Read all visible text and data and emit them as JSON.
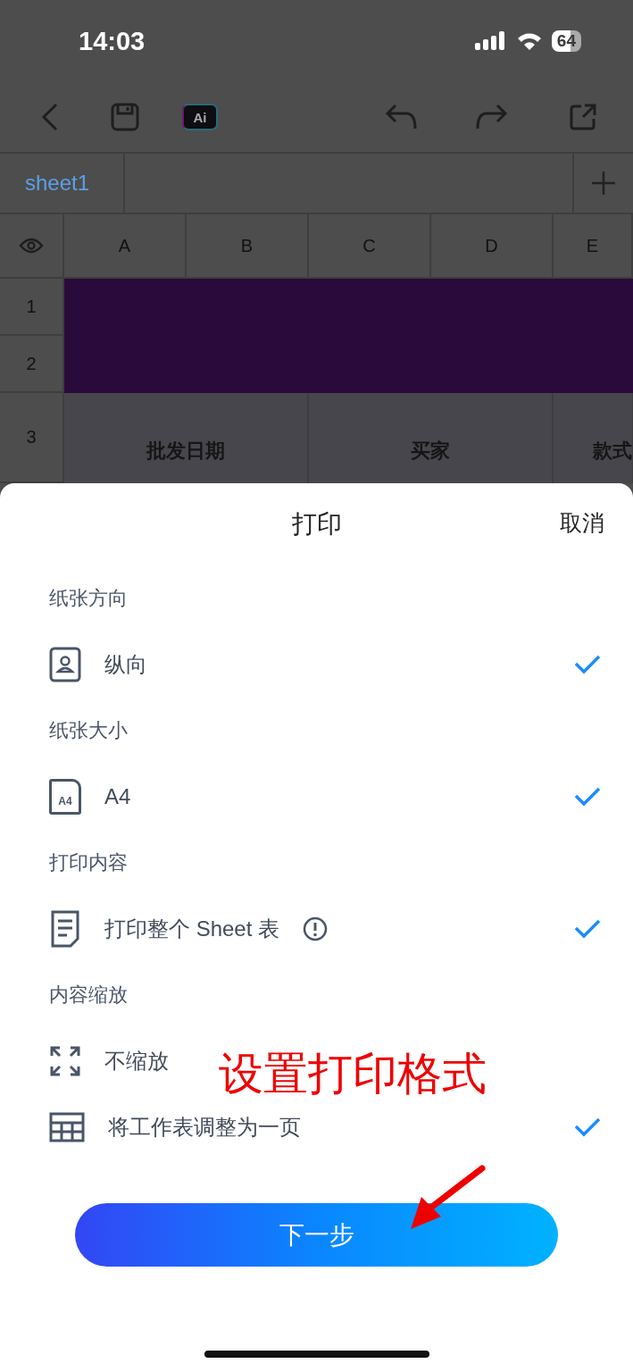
{
  "status_bar": {
    "time": "14:03",
    "battery": "64"
  },
  "toolbar": {
    "ai_button": "Ai"
  },
  "sheet_tabs": [
    {
      "label": "sheet1",
      "selected": true
    }
  ],
  "columns": [
    "A",
    "B",
    "C",
    "D",
    "E"
  ],
  "row_numbers": [
    "1",
    "2",
    "3"
  ],
  "header_cells": [
    "批发日期",
    "买家",
    "款式"
  ],
  "print_dialog": {
    "title": "打印",
    "cancel": "取消",
    "sections": [
      {
        "label": "纸张方向",
        "options": [
          {
            "kind": "portrait",
            "label": "纵向",
            "checked": true
          }
        ]
      },
      {
        "label": "纸张大小",
        "options": [
          {
            "kind": "paper",
            "icon_label": "A4",
            "label": "A4",
            "checked": true
          }
        ]
      },
      {
        "label": "打印内容",
        "options": [
          {
            "kind": "document",
            "label": "打印整个 Sheet 表",
            "info": true,
            "checked": true
          }
        ]
      },
      {
        "label": "内容缩放",
        "options": [
          {
            "kind": "expand",
            "label": "不缩放",
            "checked": false
          },
          {
            "kind": "grid",
            "label": "将工作表调整为一页",
            "checked": true
          }
        ]
      }
    ],
    "next_button": "下一步"
  },
  "annotation": "设置打印格式"
}
